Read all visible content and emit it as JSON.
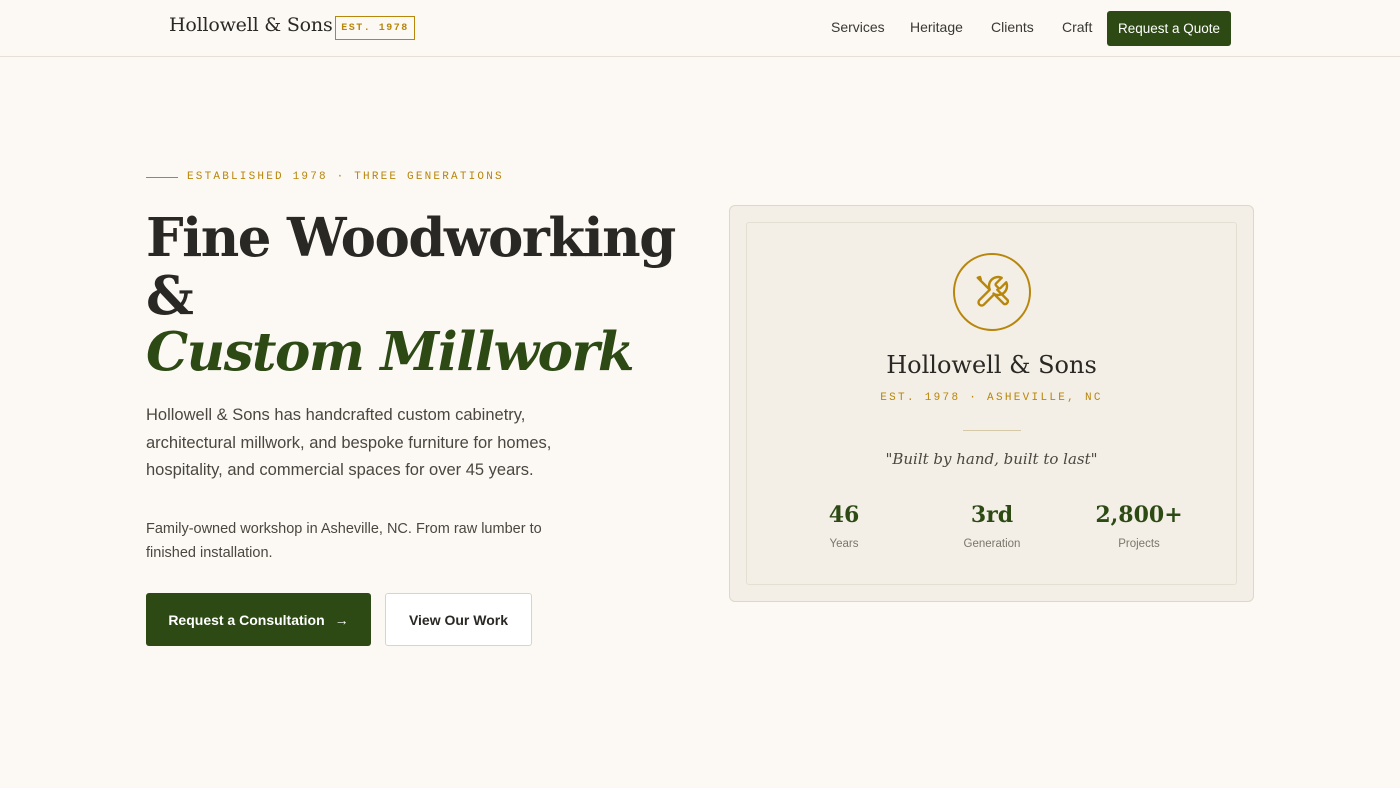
{
  "header": {
    "brand": "Hollowell & Sons",
    "est_badge": "EST. 1978",
    "nav": [
      "Services",
      "Heritage",
      "Clients",
      "Craft"
    ],
    "quote_button": "Request a Quote"
  },
  "hero": {
    "eyebrow": "ESTABLISHED 1978 · THREE GENERATIONS",
    "title_line1": "Fine Woodworking",
    "title_line2": "&",
    "title_line3": "Custom Millwork",
    "lead": "Hollowell & Sons has handcrafted custom cabinetry, architectural millwork, and bespoke furniture for homes, hospitality, and commercial spaces for over 45 years.",
    "sub": "Family-owned workshop in Asheville, NC. From raw lumber to finished installation.",
    "cta_primary": "Request a Consultation",
    "cta_primary_arrow": "→",
    "cta_secondary": "View Our Work"
  },
  "card": {
    "icon": "tools-icon",
    "title": "Hollowell & Sons",
    "est": "EST. 1978 · ASHEVILLE, NC",
    "quote": "\"Built by hand, built to last\"",
    "stats": [
      {
        "value": "46",
        "label": "Years"
      },
      {
        "value": "3rd",
        "label": "Generation"
      },
      {
        "value": "2,800+",
        "label": "Projects"
      }
    ]
  },
  "colors": {
    "accent_green": "#2d4a15",
    "accent_gold": "#b8860b",
    "background": "#fcf9f4"
  }
}
